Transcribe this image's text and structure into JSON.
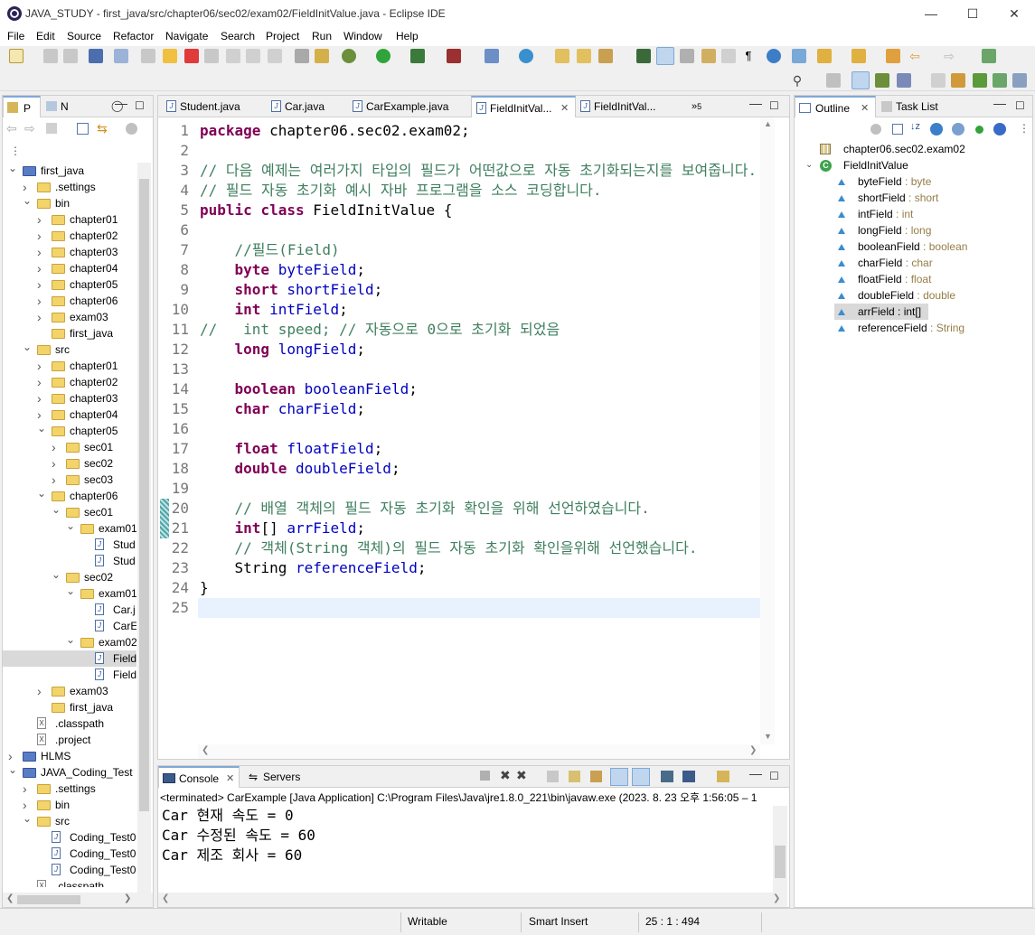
{
  "window": {
    "title": "JAVA_STUDY - first_java/src/chapter06/sec02/exam02/FieldInitValue.java - Eclipse IDE"
  },
  "menu": [
    "File",
    "Edit",
    "Source",
    "Refactor",
    "Navigate",
    "Search",
    "Project",
    "Run",
    "Window",
    "Help"
  ],
  "left_panel": {
    "tabs": [
      "P",
      "N"
    ],
    "tree": [
      {
        "label": "first_java",
        "depth": 0,
        "kind": "project",
        "expanded": true
      },
      {
        "label": ".settings",
        "depth": 1,
        "kind": "folder",
        "expanded": false
      },
      {
        "label": "bin",
        "depth": 1,
        "kind": "folder",
        "expanded": true
      },
      {
        "label": "chapter01",
        "depth": 2,
        "kind": "folder",
        "expanded": false
      },
      {
        "label": "chapter02",
        "depth": 2,
        "kind": "folder",
        "expanded": false
      },
      {
        "label": "chapter03",
        "depth": 2,
        "kind": "folder",
        "expanded": false
      },
      {
        "label": "chapter04",
        "depth": 2,
        "kind": "folder",
        "expanded": false
      },
      {
        "label": "chapter05",
        "depth": 2,
        "kind": "folder",
        "expanded": false
      },
      {
        "label": "chapter06",
        "depth": 2,
        "kind": "folder",
        "expanded": false
      },
      {
        "label": "exam03",
        "depth": 2,
        "kind": "folder",
        "expanded": false
      },
      {
        "label": "first_java",
        "depth": 2,
        "kind": "folder-leaf"
      },
      {
        "label": "src",
        "depth": 1,
        "kind": "folder",
        "expanded": true
      },
      {
        "label": "chapter01",
        "depth": 2,
        "kind": "folder",
        "expanded": false
      },
      {
        "label": "chapter02",
        "depth": 2,
        "kind": "folder",
        "expanded": false
      },
      {
        "label": "chapter03",
        "depth": 2,
        "kind": "folder",
        "expanded": false
      },
      {
        "label": "chapter04",
        "depth": 2,
        "kind": "folder",
        "expanded": false
      },
      {
        "label": "chapter05",
        "depth": 2,
        "kind": "folder",
        "expanded": true
      },
      {
        "label": "sec01",
        "depth": 3,
        "kind": "folder",
        "expanded": false
      },
      {
        "label": "sec02",
        "depth": 3,
        "kind": "folder",
        "expanded": false
      },
      {
        "label": "sec03",
        "depth": 3,
        "kind": "folder",
        "expanded": false
      },
      {
        "label": "chapter06",
        "depth": 2,
        "kind": "folder",
        "expanded": true
      },
      {
        "label": "sec01",
        "depth": 3,
        "kind": "folder",
        "expanded": true
      },
      {
        "label": "exam01",
        "depth": 4,
        "kind": "folder",
        "expanded": true
      },
      {
        "label": "Stud",
        "depth": 5,
        "kind": "java"
      },
      {
        "label": "Stud",
        "depth": 5,
        "kind": "java"
      },
      {
        "label": "sec02",
        "depth": 3,
        "kind": "folder",
        "expanded": true
      },
      {
        "label": "exam01",
        "depth": 4,
        "kind": "folder",
        "expanded": true
      },
      {
        "label": "Car.j",
        "depth": 5,
        "kind": "java"
      },
      {
        "label": "CarE",
        "depth": 5,
        "kind": "java"
      },
      {
        "label": "exam02",
        "depth": 4,
        "kind": "folder",
        "expanded": true
      },
      {
        "label": "Field",
        "depth": 5,
        "kind": "java",
        "selected": true
      },
      {
        "label": "Field",
        "depth": 5,
        "kind": "java"
      },
      {
        "label": "exam03",
        "depth": 2,
        "kind": "folder",
        "expanded": false
      },
      {
        "label": "first_java",
        "depth": 2,
        "kind": "folder-leaf"
      },
      {
        "label": ".classpath",
        "depth": 1,
        "kind": "xml"
      },
      {
        "label": ".project",
        "depth": 1,
        "kind": "xml"
      },
      {
        "label": "HLMS",
        "depth": 0,
        "kind": "project",
        "expanded": false
      },
      {
        "label": "JAVA_Coding_Test",
        "depth": 0,
        "kind": "project",
        "expanded": true
      },
      {
        "label": ".settings",
        "depth": 1,
        "kind": "folder",
        "expanded": false
      },
      {
        "label": "bin",
        "depth": 1,
        "kind": "folder",
        "expanded": false
      },
      {
        "label": "src",
        "depth": 1,
        "kind": "folder",
        "expanded": true
      },
      {
        "label": "Coding_Test0",
        "depth": 2,
        "kind": "java"
      },
      {
        "label": "Coding_Test0",
        "depth": 2,
        "kind": "java"
      },
      {
        "label": "Coding_Test0",
        "depth": 2,
        "kind": "java"
      },
      {
        "label": ".classpath",
        "depth": 1,
        "kind": "xml"
      }
    ]
  },
  "editor": {
    "tabs": [
      {
        "label": "Student.java",
        "active": false
      },
      {
        "label": "Car.java",
        "active": false
      },
      {
        "label": "CarExample.java",
        "active": false
      },
      {
        "label": "FieldInitVal...",
        "active": true
      },
      {
        "label": "FieldInitVal...",
        "active": false
      }
    ],
    "overflow": "5",
    "lines": [
      "package chapter06.sec02.exam02;",
      "",
      "// 다음 예제는 여러가지 타입의 필드가 어떤값으로 자동 초기화되는지를 보여줍니다.",
      "// 필드 자동 초기화 예시 자바 프로그램을 소스 코딩합니다.",
      "public class FieldInitValue {",
      "",
      "    //필드(Field)",
      "    byte byteField;",
      "    short shortField;",
      "    int intField;",
      "//   int speed; // 자동으로 0으로 초기화 되었음",
      "    long longField;",
      "",
      "    boolean booleanField;",
      "    char charField;",
      "",
      "    float floatField;",
      "    double doubleField;",
      "",
      "    // 배열 객체의 필드 자동 초기화 확인을 위해 선언하였습니다.",
      "    int[] arrField;",
      "    // 객체(String 객체)의 필드 자동 초기화 확인을위해 선언했습니다.",
      "    String referenceField;",
      "}",
      ""
    ]
  },
  "console": {
    "tabs": [
      "Console",
      "Servers"
    ],
    "header": "<terminated> CarExample [Java Application] C:\\Program Files\\Java\\jre1.8.0_221\\bin\\javaw.exe  (2023. 8. 23 오후 1:56:05 – 1",
    "lines": [
      "Car 현재 속도 = 0",
      "Car 수정된 속도 = 60",
      "Car 제조 회사 = 60"
    ]
  },
  "outline": {
    "tabs": [
      "Outline",
      "Task List"
    ],
    "package": "chapter06.sec02.exam02",
    "class": "FieldInitValue",
    "fields": [
      {
        "name": "byteField",
        "type": "byte"
      },
      {
        "name": "shortField",
        "type": "short"
      },
      {
        "name": "intField",
        "type": "int"
      },
      {
        "name": "longField",
        "type": "long"
      },
      {
        "name": "booleanField",
        "type": "boolean"
      },
      {
        "name": "charField",
        "type": "char"
      },
      {
        "name": "floatField",
        "type": "float"
      },
      {
        "name": "doubleField",
        "type": "double"
      },
      {
        "name": "arrField",
        "type": "int[]",
        "selected": true
      },
      {
        "name": "referenceField",
        "type": "String"
      }
    ]
  },
  "status": {
    "writable": "Writable",
    "insert": "Smart Insert",
    "position": "25 : 1 : 494"
  }
}
